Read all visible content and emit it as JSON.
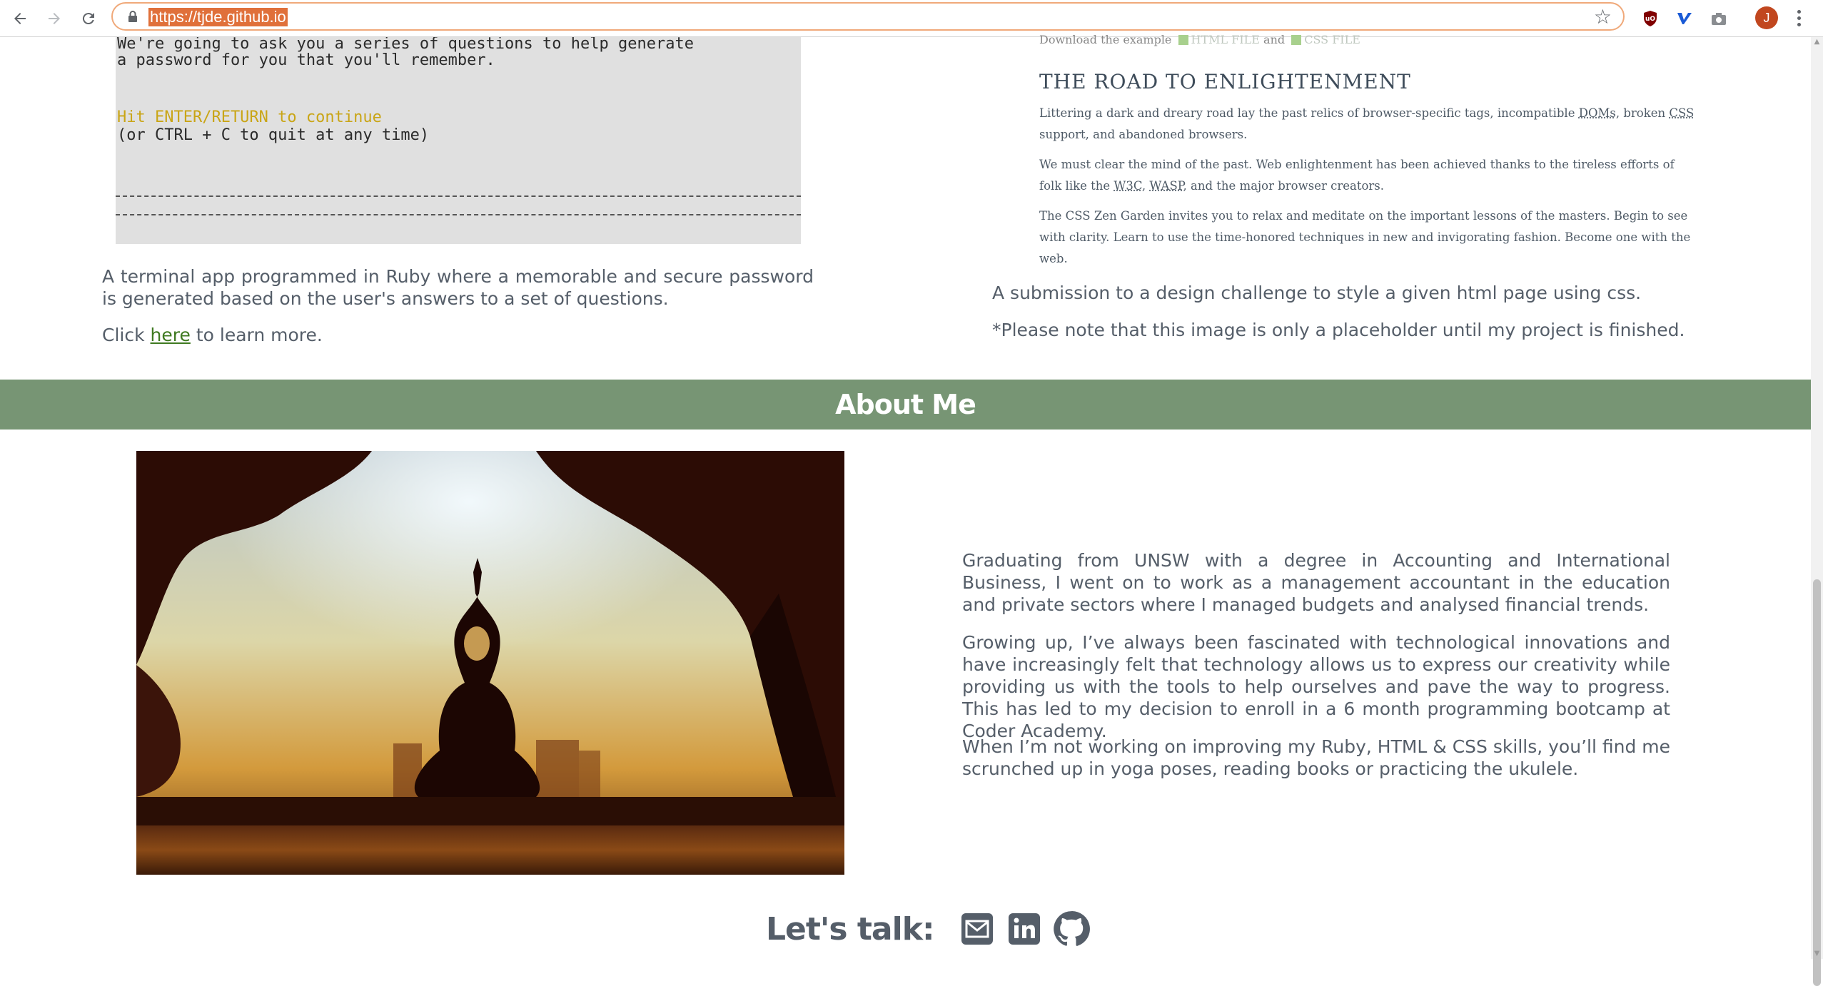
{
  "browser": {
    "url": "https://tjde.github.io",
    "avatar_letter": "J",
    "extensions": [
      "ublock-origin-icon",
      "vimeo-extension-icon",
      "camera-icon"
    ]
  },
  "terminal": {
    "line1": "We're going to ask you a series of questions to help generate",
    "line2": "a password for you that you'll remember.",
    "continue": "Hit ENTER/RETURN to continue",
    "quit": "(or CTRL + C to quit at any time)"
  },
  "password_project": {
    "description": "A terminal app programmed in Ruby where a memorable and secure password is generated based on the user's answers to a set of questions.",
    "click_prefix": "Click",
    "link_text": "here",
    "click_suffix": "to learn more."
  },
  "zen_garden": {
    "top_line_prefix": "Download the example",
    "html_file": "HTML FILE",
    "and": "and",
    "css_file": "CSS FILE",
    "heading": "THE ROAD TO ENLIGHTENMENT",
    "p1_a": "Littering a dark and dreary road lay the past relics of browser-specific tags, incompatible",
    "p1_doms": "DOMs",
    "p1_b": ", broken",
    "p1_css": "CSS",
    "p1_c": "support, and abandoned browsers.",
    "p2_a": "We must clear the mind of the past. Web enlightenment has been achieved thanks to the tireless efforts of folk like the",
    "p2_w3c": "W3C",
    "p2_sep": ",",
    "p2_wasp": "WASP",
    "p2_b": ", and the major browser creators.",
    "p3": "The CSS Zen Garden invites you to relax and meditate on the important lessons of the masters. Begin to see with clarity. Learn to use the time-honored techniques in new and invigorating fashion. Become one with the web."
  },
  "zen_project": {
    "description": "A submission to a design challenge to style a given html page using css.",
    "note": "*Please note that this image is only a placeholder until my project is finished."
  },
  "about": {
    "title": "About Me",
    "p1": "Graduating from UNSW with a degree in Accounting and International Business, I went on to work as a management accountant in the education and private sectors where I managed budgets and analysed financial trends.",
    "p2": "Growing up, I’ve always been fascinated with technological innovations and have increasingly felt that technology allows us to express our creativity while providing us with the tools to help ourselves and pave the way to progress. This has led to my decision to enroll in a 6 month programming bootcamp at Coder Academy.",
    "p3": "When I’m not working on improving my Ruby, HTML & CSS skills, you’ll find me scrunched up in yoga poses, reading books or practicing the ukulele."
  },
  "contact": {
    "label": "Let's talk:",
    "icons": [
      "email-icon",
      "linkedin-icon",
      "github-icon"
    ]
  },
  "colors": {
    "accent_green": "#779574",
    "link_green": "#3f7a21",
    "text_gray": "#555e69",
    "terminal_gold": "#c9a516"
  }
}
